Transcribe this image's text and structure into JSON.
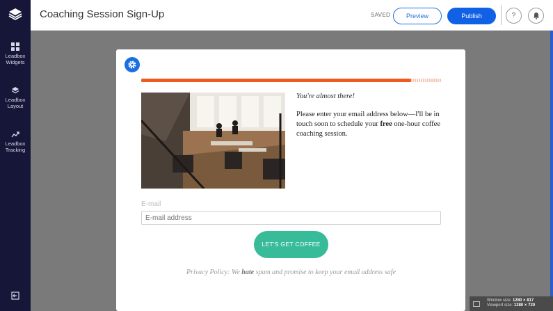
{
  "header": {
    "title": "Coaching Session Sign-Up",
    "status": "SAVED",
    "preview_label": "Preview",
    "publish_label": "Publish",
    "help_label": "?"
  },
  "sidebar": {
    "items": [
      {
        "label_line1": "Leadbox",
        "label_line2": "Widgets",
        "icon": "grid-icon"
      },
      {
        "label_line1": "Leadbox",
        "label_line2": "Layout",
        "icon": "layers-icon"
      },
      {
        "label_line1": "Leadbox",
        "label_line2": "Tracking",
        "icon": "trend-icon"
      }
    ],
    "exit_icon": "exit-icon"
  },
  "leadbox": {
    "progress_percent": 90,
    "progress_color": "#ef5a1f",
    "headline": "You're almost there!",
    "body_before": "Please enter your email address below—I'll be in touch soon to schedule your ",
    "body_bold": "free",
    "body_after": " one-hour coffee coaching session.",
    "field_label": "E-mail",
    "email_placeholder": "E-mail address",
    "cta_label": "LET'S GET COFFEE",
    "cta_color": "#37bb98",
    "privacy_before": "Privacy Policy: We ",
    "privacy_bold": "hate",
    "privacy_after": " spam and promise to keep your email address safe"
  },
  "window_info": {
    "window_label": "Window size:",
    "window_value": "1280 × 817",
    "viewport_label": "Viewport size:",
    "viewport_value": "1280 × 720"
  },
  "colors": {
    "accent": "#1061e6",
    "sidebar": "#161638"
  }
}
